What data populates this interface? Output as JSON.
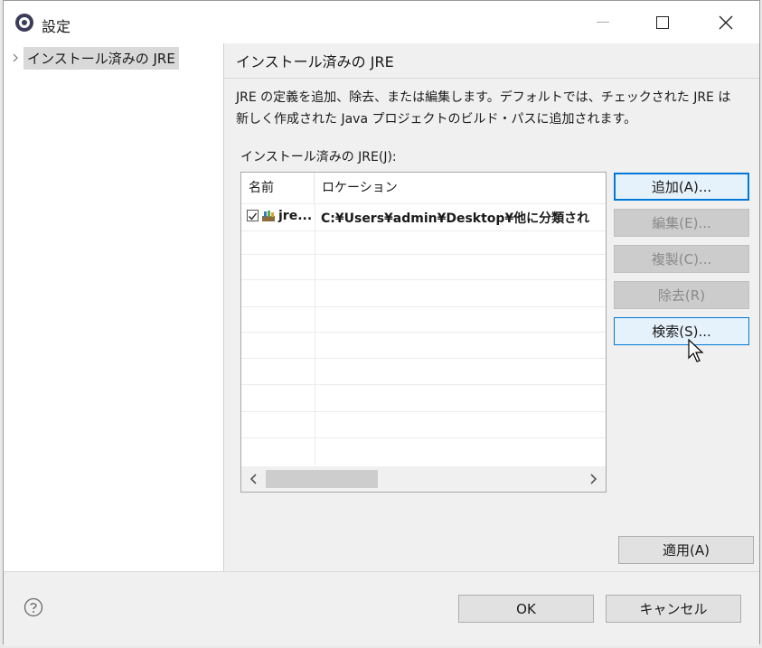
{
  "window": {
    "title": "設定"
  },
  "sidebar": {
    "items": [
      {
        "label": "インストール済みの JRE"
      }
    ]
  },
  "page": {
    "title": "インストール済みの JRE",
    "description_line1": "JRE の定義を追加、除去、または編集します。デフォルトでは、チェックされた JRE は",
    "description_line2": "新しく作成された Java プロジェクトのビルド・パスに追加されます。",
    "group_label": "インストール済みの JRE(J):"
  },
  "table": {
    "headers": {
      "name": "名前",
      "location": "ロケーション"
    },
    "rows": [
      {
        "checked": true,
        "name": "jre...",
        "location": "C:¥Users¥admin¥Desktop¥他に分類され"
      }
    ]
  },
  "buttons": {
    "add": "追加(A)...",
    "edit": "編集(E)...",
    "duplicate": "複製(C)...",
    "remove": "除去(R)",
    "search": "検索(S)...",
    "apply": "適用(A)",
    "ok": "OK",
    "cancel": "キャンセル"
  },
  "colors": {
    "accent": "#0078d7",
    "selection": "#d9d9d9"
  }
}
